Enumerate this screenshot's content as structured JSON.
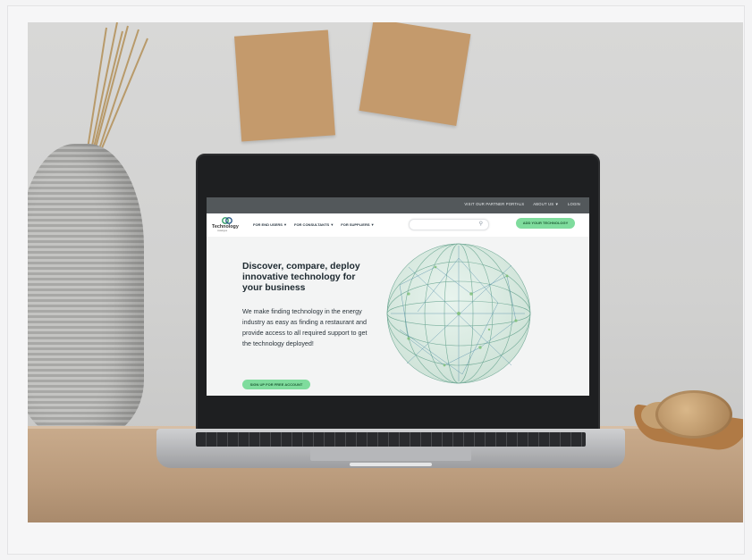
{
  "website": {
    "topbar": {
      "links": [
        "VISIT OUR PARTNER PORTALS",
        "ABOUT US",
        "LOGIN"
      ]
    },
    "logo": {
      "name": "Technology",
      "tagline": "catalogue"
    },
    "nav": {
      "items": [
        "FOR END USERS",
        "FOR CONSULTANTS",
        "FOR SUPPLIERS"
      ]
    },
    "search": {
      "placeholder": "",
      "icon": "search-icon"
    },
    "add_button": "ADD YOUR TECHNOLOGY",
    "hero": {
      "title": "Discover, compare, deploy innovative technology for your business",
      "body": "We make finding technology in the energy industry as easy as finding a restaurant and provide access to all required support to get the technology deployed!",
      "cta": "SIGN UP FOR FREE ACCOUNT"
    }
  },
  "colors": {
    "accent_green": "#7fdc9d",
    "topbar": "#53585b",
    "desk": "#b99a7b",
    "notes": "#c49a6c"
  }
}
